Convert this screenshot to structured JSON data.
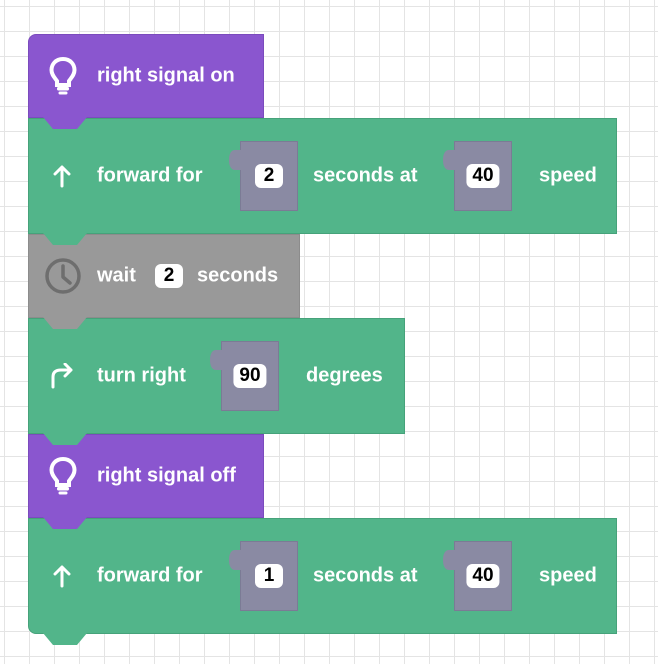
{
  "blocks": {
    "b1": {
      "label": "right signal on",
      "icon": "lightbulb-icon",
      "color": "#8a56cf"
    },
    "b2": {
      "pre": "forward for",
      "seconds_value": "2",
      "mid": "seconds at",
      "speed_value": "40",
      "post": "speed",
      "icon": "arrow-up-icon",
      "color": "#52b58a"
    },
    "b3": {
      "pre": "wait",
      "seconds_value": "2",
      "post": "seconds",
      "icon": "clock-icon",
      "color": "#999999"
    },
    "b4": {
      "pre": "turn right",
      "degrees_value": "90",
      "post": "degrees",
      "icon": "turn-right-arrow-icon",
      "color": "#52b58a"
    },
    "b5": {
      "label": "right signal off",
      "icon": "lightbulb-icon",
      "color": "#8a56cf"
    },
    "b6": {
      "pre": "forward for",
      "seconds_value": "1",
      "mid": "seconds at",
      "speed_value": "40",
      "post": "speed",
      "icon": "arrow-up-icon",
      "color": "#52b58a"
    }
  },
  "colors": {
    "slot": "#8a8aa3",
    "grid": "#e4e4e4",
    "background": "#ffffff"
  }
}
